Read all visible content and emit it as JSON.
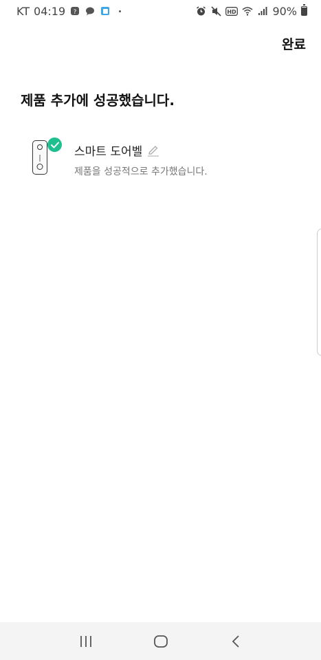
{
  "status_bar": {
    "carrier": "KT",
    "time": "04:19",
    "battery_percent": "90%",
    "battery_level": 0.9,
    "left_icons": [
      "app-icon",
      "chat-icon",
      "square-app-icon"
    ],
    "right_icons": [
      "alarm-icon",
      "mute-icon",
      "hd-icon",
      "wifi-icon",
      "signal-icon"
    ]
  },
  "header": {
    "done_label": "완료"
  },
  "main": {
    "title": "제품 추가에 성공했습니다.",
    "device": {
      "name": "스마트 도어벨",
      "status": "제품을 성공적으로 추가했습니다.",
      "badge_color": "#1fbf8f"
    }
  },
  "nav": {
    "buttons": [
      "recent-apps",
      "home",
      "back"
    ]
  }
}
